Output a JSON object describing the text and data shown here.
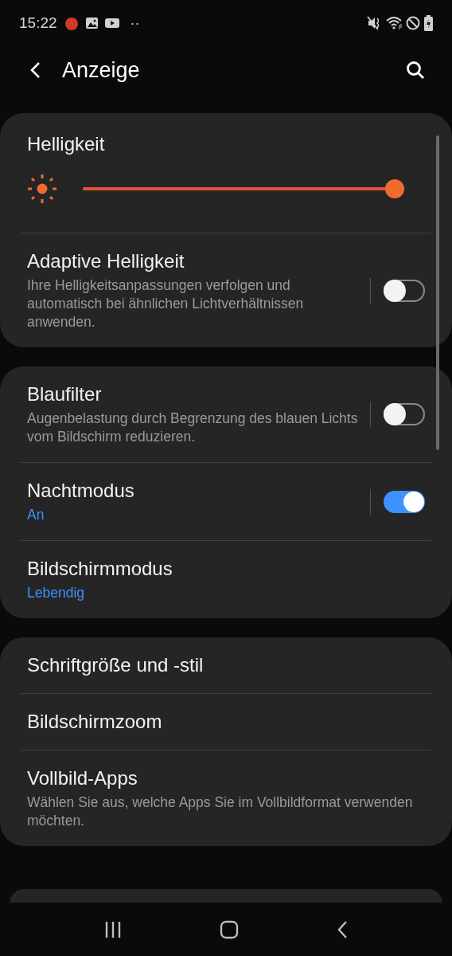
{
  "status_bar": {
    "time": "15:22",
    "more": "··"
  },
  "header": {
    "title": "Anzeige"
  },
  "groups": [
    {
      "items": [
        {
          "kind": "slider",
          "title": "Helligkeit",
          "level": 1.0
        },
        {
          "kind": "switch",
          "title": "Adaptive Helligkeit",
          "summary": "Ihre Helligkeitsanpassungen verfolgen und automatisch bei ähnlichen Lichtverhältnissen anwenden.",
          "on": false
        }
      ]
    },
    {
      "items": [
        {
          "kind": "switch",
          "title": "Blaufilter",
          "summary": "Augenbelastung durch Begrenzung des blauen Lichts vom Bildschirm reduzieren.",
          "on": false
        },
        {
          "kind": "switch",
          "title": "Nachtmodus",
          "value": "An",
          "on": true
        },
        {
          "kind": "link",
          "title": "Bildschirmmodus",
          "value": "Lebendig"
        }
      ]
    },
    {
      "items": [
        {
          "kind": "link",
          "title": "Schriftgröße und -stil"
        },
        {
          "kind": "link",
          "title": "Bildschirmzoom"
        },
        {
          "kind": "link",
          "title": "Vollbild-Apps",
          "summary": "Wählen Sie aus, welche Apps Sie im Vollbildformat verwenden möchten."
        }
      ]
    }
  ]
}
